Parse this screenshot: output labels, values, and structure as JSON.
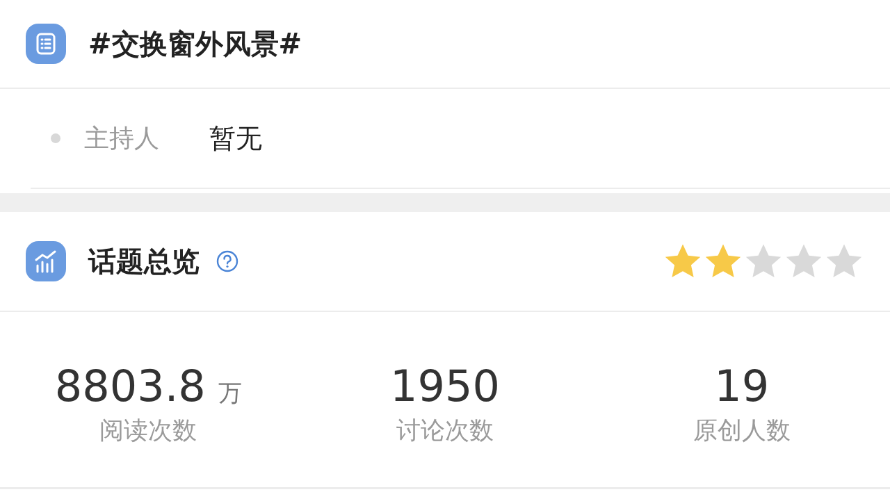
{
  "topic": {
    "title": "#交换窗外风景#"
  },
  "host": {
    "label": "主持人",
    "value": "暂无"
  },
  "overview": {
    "title": "话题总览",
    "stars": 2
  },
  "stats": [
    {
      "value": "8803.8",
      "unit": "万",
      "label": "阅读次数"
    },
    {
      "value": "1950",
      "label": "讨论次数"
    },
    {
      "value": "19",
      "label": "原创人数"
    }
  ]
}
